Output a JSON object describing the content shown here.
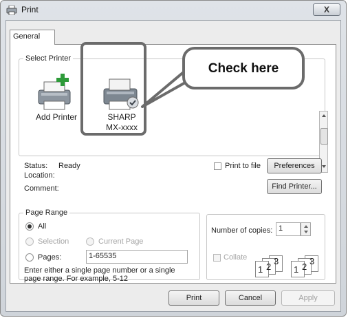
{
  "window": {
    "title": "Print",
    "close_glyph": "X"
  },
  "tabs": [
    {
      "label": "General"
    }
  ],
  "select_printer": {
    "legend": "Select Printer",
    "printers": [
      {
        "line1": "Add Printer",
        "line2": ""
      },
      {
        "line1": "SHARP",
        "line2": "MX-xxxx"
      }
    ],
    "status_label": "Status:",
    "status_value": "Ready",
    "location_label": "Location:",
    "comment_label": "Comment:",
    "print_to_file_label": "Print to file",
    "preferences_label": "Preferences",
    "find_printer_label": "Find Printer..."
  },
  "callout": {
    "text": "Check here"
  },
  "page_range": {
    "legend": "Page Range",
    "all_label": "All",
    "selection_label": "Selection",
    "current_page_label": "Current Page",
    "pages_label": "Pages:",
    "pages_value": "1-65535",
    "help_line1": "Enter either a single page number or a single",
    "help_line2": "page range.  For example, 5-12"
  },
  "copies": {
    "number_label": "Number of copies:",
    "number_value": "1",
    "collate_label": "Collate",
    "collate_pages": [
      "1",
      "2",
      "3"
    ]
  },
  "footer": {
    "print_label": "Print",
    "cancel_label": "Cancel",
    "apply_label": "Apply"
  }
}
